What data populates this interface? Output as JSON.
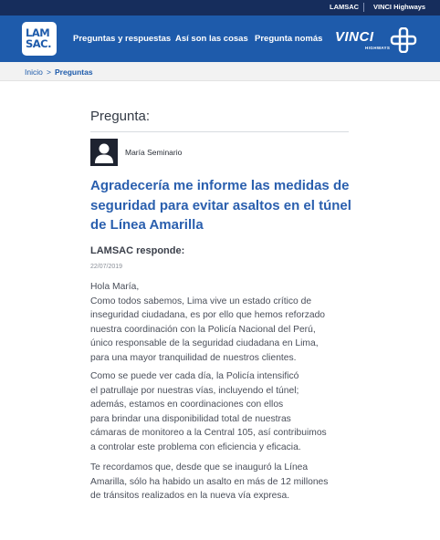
{
  "topbar": {
    "link_lamsac": "LAMSAC",
    "link_vinci": "VINCI Highways"
  },
  "header": {
    "logo_line1": "LAM",
    "logo_line2": "SAC.",
    "nav": [
      "Preguntas y respuestas",
      "Así son las cosas",
      "Pregunta nomás"
    ],
    "brand_word": "VINCI",
    "brand_sub": "HIGHWAYS"
  },
  "breadcrumb": {
    "home": "Inicio",
    "separator": ">",
    "current": "Preguntas"
  },
  "main": {
    "section_title": "Pregunta:",
    "author": "María Seminario",
    "question": "Agradecería me informe las medidas de seguridad para evitar asaltos en el túnel de Línea Amarilla",
    "responder": "LAMSAC responde:",
    "date": "22/07/2019",
    "answer_lines": [
      [
        "Hola María,",
        "Como todos sabemos, Lima vive un estado crítico de",
        "inseguridad ciudadana, es por ello que hemos reforzado",
        "nuestra coordinación con la Policía Nacional del Perú,",
        "único responsable de la seguridad ciudadana en Lima,",
        "para una mayor tranquilidad de nuestros clientes."
      ],
      [
        "Como se puede ver cada día, la Policía intensificó",
        "el patrullaje por nuestras vías, incluyendo el túnel;",
        "además, estamos en coordinaciones con ellos",
        "para brindar una disponibilidad total de nuestras",
        "cámaras de monitoreo a la Central 105, así contribuimos",
        "a controlar este problema con eficiencia y eficacia."
      ],
      [
        "Te recordamos que, desde que se inauguró la Línea",
        "Amarilla, sólo ha habido un asalto en más de 12 millones",
        "de tránsitos realizados en la nueva vía expresa."
      ]
    ]
  },
  "colors": {
    "topbar": "#162d5c",
    "navbar": "#1e5bab",
    "question_text": "#2a5fae",
    "breadcrumb_bg": "#f2f2f2"
  }
}
